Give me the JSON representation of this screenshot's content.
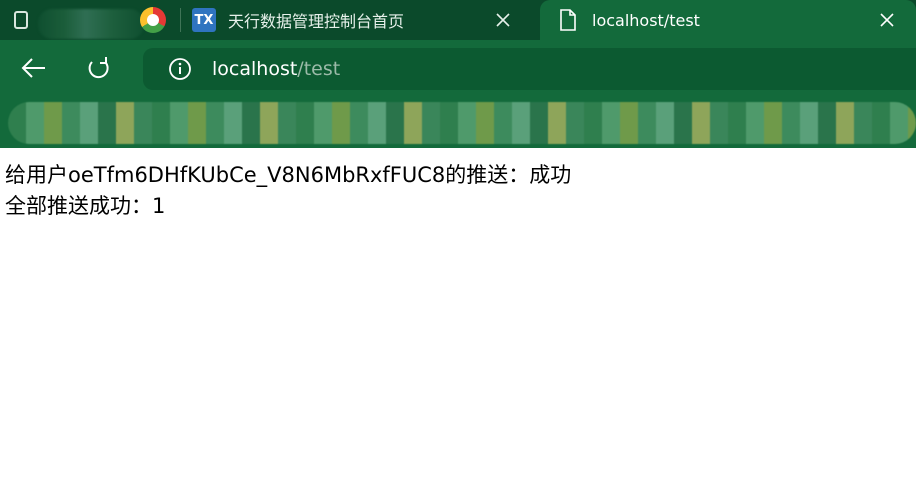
{
  "tabs": [
    {
      "title": "天行数据管理控制台首页",
      "icon": "tianapi-logo-icon",
      "logo_text": "TX",
      "active": false
    },
    {
      "title": "localhost/test",
      "icon": "document-icon",
      "active": true
    }
  ],
  "address_bar": {
    "host": "localhost",
    "path": "/test"
  },
  "content": {
    "lines": [
      "给用户oeTfm6DHfKUbCe_V8N6MbRxfFUC8的推送：成功",
      "全部推送成功：1"
    ]
  },
  "colors": {
    "tabstrip": "#0b4a2b",
    "toolbar": "#136a3b",
    "address_bar": "#0c5a31"
  }
}
